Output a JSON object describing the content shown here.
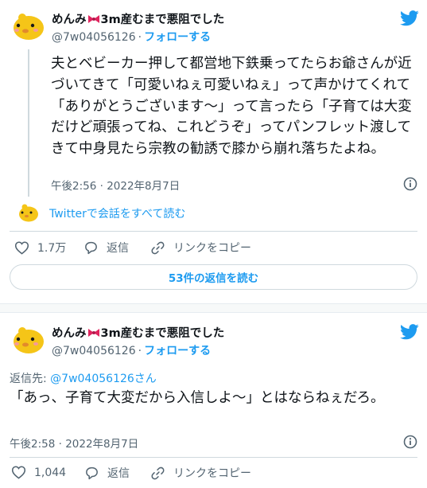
{
  "tweet1": {
    "display_name": "めんみ",
    "display_name_suffix": "3m産むまで悪阻でした",
    "handle": "@7w04056126",
    "separator": "·",
    "follow_label": "フォローする",
    "text": "夫とベビーカー押して都営地下鉄乗ってたらお爺さんが近づいてきて「可愛いねぇ可愛いねぇ」って声かけてくれて「ありがとうございます〜」って言ったら「子育ては大変だけど頑張ってね、これどうぞ」ってパンフレット渡してきて中身見たら宗教の勧誘で膝から崩れ落ちたよね。",
    "timestamp": "午後2:56 · 2022年8月7日",
    "thread_link": "Twitterで会話をすべて読む",
    "likes": "1.7万",
    "reply_label": "返信",
    "copy_link_label": "リンクをコピー",
    "read_replies_label": "53件の返信を読む"
  },
  "tweet2": {
    "display_name": "めんみ",
    "display_name_suffix": "3m産むまで悪阻でした",
    "handle": "@7w04056126",
    "separator": "·",
    "follow_label": "フォローする",
    "reply_to_prefix": "返信先: ",
    "reply_to_handle": "@7w04056126さん",
    "text": "「あっ、子育て大変だから入信しよ〜」とはならねぇだろ。",
    "timestamp": "午後2:58 · 2022年8月7日",
    "likes": "1,044",
    "reply_label": "返信",
    "copy_link_label": "リンクをコピー"
  },
  "colors": {
    "accent": "#1d9bf0",
    "secondary_text": "#536471",
    "like_heart": "#536471",
    "avatar_yellow": "#f5c518"
  },
  "icons": [
    "avatar-chick-icon",
    "bow-icon",
    "twitter-bird-icon",
    "info-icon",
    "heart-icon",
    "reply-bubble-icon",
    "link-icon"
  ]
}
